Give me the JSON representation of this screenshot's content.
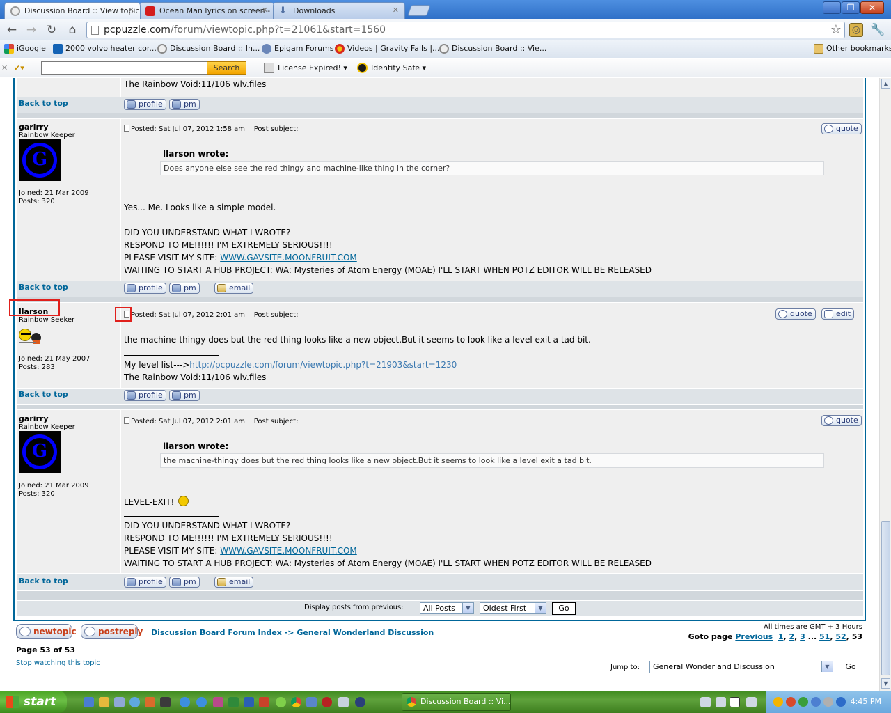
{
  "tabs": [
    {
      "title": "Discussion Board :: View topic",
      "icon": "gc-icon"
    },
    {
      "title": "Ocean Man lyrics on screen -",
      "icon": "youtube-icon"
    },
    {
      "title": "Downloads",
      "icon": "download-icon"
    }
  ],
  "address": {
    "host": "pcpuzzle.com",
    "path": "/forum/viewtopic.php?t=21061&start=1560"
  },
  "bookmarks": [
    {
      "label": "iGoogle"
    },
    {
      "label": "2000 volvo heater cor..."
    },
    {
      "label": "Discussion Board :: In..."
    },
    {
      "label": "Epigam Forums"
    },
    {
      "label": "Videos | Gravity Falls |..."
    },
    {
      "label": "Discussion Board :: Vie..."
    }
  ],
  "other_bookmarks": "Other bookmarks",
  "ext_toolbar": {
    "search_button": "Search",
    "license": "License Expired!",
    "identity": "Identity Safe"
  },
  "forum": {
    "top_post": {
      "sig_tail": "The Rainbow Void:11/106 wlv.files"
    },
    "back_to_top": "Back to top",
    "buttons": {
      "profile": "profile",
      "pm": "pm",
      "email": "email",
      "quote": "quote",
      "edit": "edit"
    },
    "post_subject_label": "Post subject:",
    "posts": [
      {
        "author": "garirry",
        "rank": "Rainbow Keeper",
        "joined": "Joined: 21 Mar 2009",
        "posts": "Posts: 320",
        "posted": "Posted: Sat Jul 07, 2012 1:58 am",
        "quote_author": "llarson wrote:",
        "quote_text": "Does anyone else see the red thingy and machine-like thing in the corner?",
        "body": "Yes... Me. Looks like a simple model.",
        "signature": [
          "DID YOU UNDERSTAND WHAT I WROTE?",
          "RESPOND TO ME!!!!!! I'M EXTREMELY SERIOUS!!!!",
          "PLEASE VISIT MY SITE: ",
          "WWW.GAVSITE.MOONFRUIT.COM",
          "WAITING TO START A HUB PROJECT: WA: Mysteries of Atom Energy (MOAE) I'LL START WHEN POTZ EDITOR WILL BE RELEASED"
        ]
      },
      {
        "author": "llarson",
        "rank": "Rainbow Seeker",
        "joined": "Joined: 21 May 2007",
        "posts": "Posts: 283",
        "posted": "Posted: Sat Jul 07, 2012 2:01 am",
        "body": "the machine-thingy does but the red thing looks like a new object.But it seems to look like a level exit a tad bit.",
        "sig_prefix": "My level list--->",
        "sig_link": "http://pcpuzzle.com/forum/viewtopic.php?t=21903&start=1230",
        "sig_tail": "The Rainbow Void:11/106 wlv.files"
      },
      {
        "author": "garirry",
        "rank": "Rainbow Keeper",
        "joined": "Joined: 21 Mar 2009",
        "posts": "Posts: 320",
        "posted": "Posted: Sat Jul 07, 2012 2:01 am",
        "quote_author": "llarson wrote:",
        "quote_text": "the machine-thingy does but the red thing looks like a new object.But it seems to look like a level exit a tad bit.",
        "body": "LEVEL-EXIT!",
        "signature": [
          "DID YOU UNDERSTAND WHAT I WROTE?",
          "RESPOND TO ME!!!!!! I'M EXTREMELY SERIOUS!!!!",
          "PLEASE VISIT MY SITE: ",
          "WWW.GAVSITE.MOONFRUIT.COM",
          "WAITING TO START A HUB PROJECT: WA: Mysteries of Atom Energy (MOAE) I'LL START WHEN POTZ EDITOR WILL BE RELEASED"
        ]
      }
    ],
    "display_label": "Display posts from previous:",
    "filter_value": "All Posts",
    "order_value": "Oldest First",
    "go": "Go",
    "new_topic": "newtopic",
    "post_reply": "postreply",
    "breadcrumb_index": "Discussion Board Forum Index",
    "breadcrumb_sep": " -> ",
    "breadcrumb_forum": "General Wonderland Discussion",
    "timezone": "All times are GMT + 3 Hours",
    "goto_label": "Goto page ",
    "goto_previous": "Previous",
    "goto_pages": [
      "1",
      "2",
      "3",
      "51",
      "52"
    ],
    "goto_current": "53",
    "page_of": "Page 53 of 53",
    "stop_watching": "Stop watching this topic",
    "jump_label": "Jump to:",
    "jump_value": "General Wonderland Discussion"
  },
  "taskbar": {
    "start": "start",
    "item": "Discussion Board :: Vi...",
    "clock": "4:45 PM"
  }
}
